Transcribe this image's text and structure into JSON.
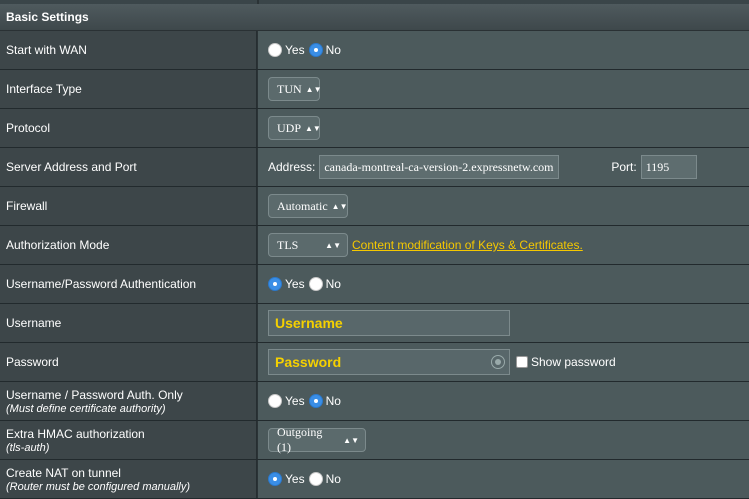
{
  "section_title": "Basic Settings",
  "rows": {
    "start_wan": {
      "label": "Start with WAN",
      "yes": "Yes",
      "no": "No",
      "selected": "no"
    },
    "interface_type": {
      "label": "Interface Type",
      "value": "TUN"
    },
    "protocol": {
      "label": "Protocol",
      "value": "UDP"
    },
    "server": {
      "label": "Server Address and Port",
      "address_label": "Address:",
      "address_value": "canada-montreal-ca-version-2.expressnetw.com",
      "port_label": "Port:",
      "port_value": "1195"
    },
    "firewall": {
      "label": "Firewall",
      "value": "Automatic"
    },
    "auth_mode": {
      "label": "Authorization Mode",
      "value": "TLS",
      "link": "Content modification of Keys & Certificates."
    },
    "userpass_auth": {
      "label": "Username/Password Authentication",
      "yes": "Yes",
      "no": "No",
      "selected": "yes"
    },
    "username": {
      "label": "Username",
      "value": "Username"
    },
    "password": {
      "label": "Password",
      "value": "Password",
      "show_label": "Show password"
    },
    "userpass_only": {
      "label": "Username / Password Auth. Only",
      "sub": "(Must define certificate authority)",
      "yes": "Yes",
      "no": "No",
      "selected": "no"
    },
    "hmac": {
      "label": "Extra HMAC authorization",
      "sub": "(tls-auth)",
      "value": "Outgoing (1)"
    },
    "nat": {
      "label": "Create NAT on tunnel",
      "sub": "(Router must be configured manually)",
      "yes": "Yes",
      "no": "No",
      "selected": "yes"
    }
  }
}
